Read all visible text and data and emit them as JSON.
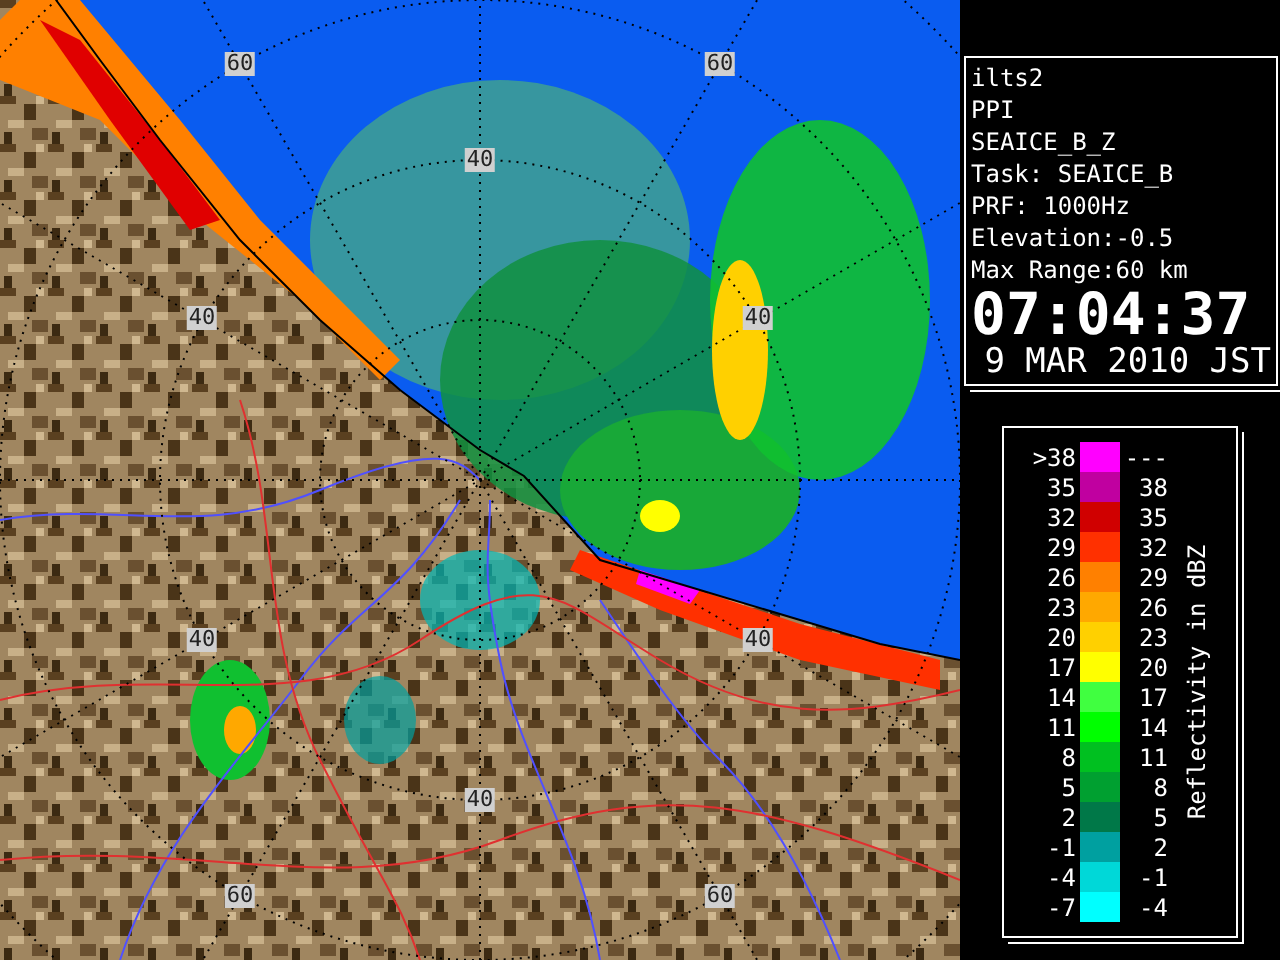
{
  "radar_map": {
    "range_labels": [
      "60",
      "60",
      "40",
      "40",
      "40",
      "40",
      "40",
      "40",
      "60",
      "60"
    ]
  },
  "info": {
    "lines": [
      "ilts2",
      "PPI",
      "SEAICE_B_Z",
      "Task: SEAICE_B",
      "PRF: 1000Hz",
      "Elevation:-0.5",
      "Max Range:60 km"
    ],
    "time": "07:04:37",
    "date": "9 MAR 2010 JST"
  },
  "legend": {
    "title": "Reflectivity in dBZ",
    "rows": [
      {
        "low": ">38",
        "high": "---",
        "color": "#ff00ff"
      },
      {
        "low": "35",
        "high": "38",
        "color": "#c000a0"
      },
      {
        "low": "32",
        "high": "35",
        "color": "#d00000"
      },
      {
        "low": "29",
        "high": "32",
        "color": "#ff3000"
      },
      {
        "low": "26",
        "high": "29",
        "color": "#ff8000"
      },
      {
        "low": "23",
        "high": "26",
        "color": "#ffa800"
      },
      {
        "low": "20",
        "high": "23",
        "color": "#ffd000"
      },
      {
        "low": "17",
        "high": "20",
        "color": "#ffff00"
      },
      {
        "low": "14",
        "high": "17",
        "color": "#40ff40"
      },
      {
        "low": "11",
        "high": "14",
        "color": "#00ff00"
      },
      {
        "low": "8",
        "high": "11",
        "color": "#00c020"
      },
      {
        "low": "5",
        "high": "8",
        "color": "#00a030"
      },
      {
        "low": "2",
        "high": "5",
        "color": "#007848"
      },
      {
        "low": "-1",
        "high": "2",
        "color": "#00a0a0"
      },
      {
        "low": "-4",
        "high": "-1",
        "color": "#00d8d8"
      },
      {
        "low": "-7",
        "high": "-4",
        "color": "#00ffff"
      }
    ]
  }
}
